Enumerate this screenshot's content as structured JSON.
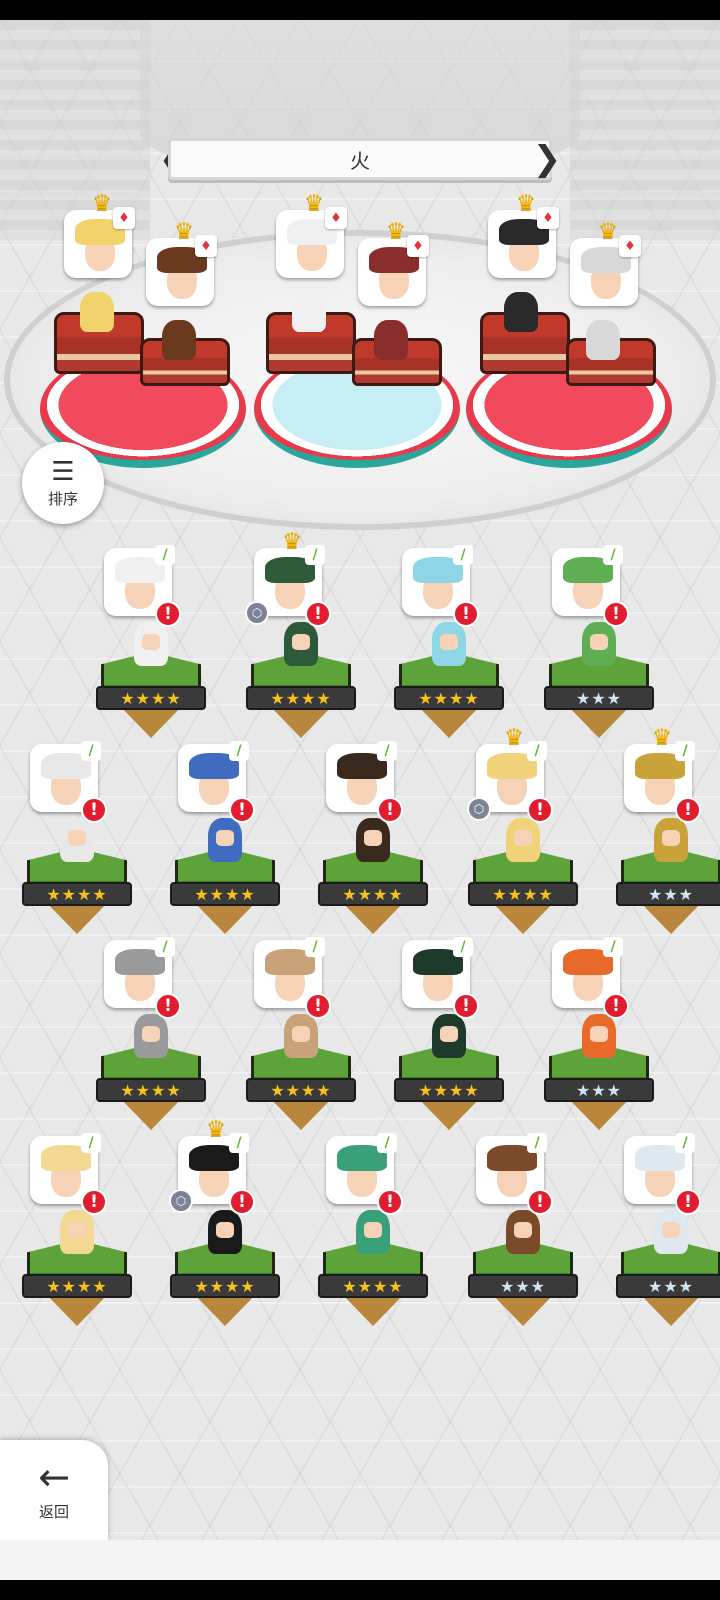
{
  "header": {
    "element_label": "火",
    "prev_arrow": "❮",
    "next_arrow": "❯"
  },
  "sort_button": {
    "icon": "sort-icon",
    "label": "排序"
  },
  "back_button": {
    "icon": "arrow-left-icon",
    "label": "返回"
  },
  "icons": {
    "crown": "♛",
    "fire_badge": "♦",
    "leaf_badge": "/",
    "alert": "!",
    "gem": "⬡"
  },
  "colors": {
    "alert": "#e21c2f",
    "gold_star": "#f7c21b",
    "silver_star": "#cfe4f4",
    "grass": "#5ea33a",
    "pedestal_red": "#f04a5c",
    "pedestal_blue": "#c6eef4"
  },
  "team": [
    {
      "crown": true,
      "badge": "fire",
      "hair": "#f2d36b"
    },
    {
      "crown": true,
      "badge": "fire",
      "hair": "#6b3a1e"
    },
    {
      "crown": true,
      "badge": "fire",
      "hair": "#f0f0f0"
    },
    {
      "crown": true,
      "badge": "fire",
      "hair": "#8a2d2d"
    },
    {
      "crown": true,
      "badge": "fire",
      "hair": "#2a2a2a"
    },
    {
      "crown": true,
      "badge": "fire",
      "hair": "#d8d8d8"
    }
  ],
  "heroes": [
    {
      "stars": "★★★★",
      "tier": "gold",
      "crown": false,
      "gem": false,
      "hair": "#f0f0f0"
    },
    {
      "stars": "★★★★",
      "tier": "gold",
      "crown": true,
      "gem": true,
      "hair": "#2f5a3a"
    },
    {
      "stars": "★★★★",
      "tier": "gold",
      "crown": false,
      "gem": false,
      "hair": "#8ed6e6"
    },
    {
      "stars": "★★★",
      "tier": "silver",
      "crown": false,
      "gem": false,
      "hair": "#5fae54"
    },
    {
      "stars": "★★★★",
      "tier": "gold",
      "crown": false,
      "gem": false,
      "hair": "#e8e8e8"
    },
    {
      "stars": "★★★★",
      "tier": "gold",
      "crown": false,
      "gem": false,
      "hair": "#3f6cc0"
    },
    {
      "stars": "★★★★",
      "tier": "gold",
      "crown": false,
      "gem": false,
      "hair": "#3a2a1e"
    },
    {
      "stars": "★★★★",
      "tier": "gold",
      "crown": true,
      "gem": true,
      "hair": "#f0d27a"
    },
    {
      "stars": "★★★",
      "tier": "silver",
      "crown": true,
      "gem": false,
      "hair": "#c9a23a"
    },
    {
      "stars": "★★★★",
      "tier": "gold",
      "crown": false,
      "gem": false,
      "hair": "#9a9a9a"
    },
    {
      "stars": "★★★★",
      "tier": "gold",
      "crown": false,
      "gem": false,
      "hair": "#c9a27a"
    },
    {
      "stars": "★★★★",
      "tier": "gold",
      "crown": false,
      "gem": false,
      "hair": "#1e3a2a"
    },
    {
      "stars": "★★★",
      "tier": "silver",
      "crown": false,
      "gem": false,
      "hair": "#e86a2a"
    },
    {
      "stars": "★★★★",
      "tier": "gold",
      "crown": false,
      "gem": false,
      "hair": "#f2d890"
    },
    {
      "stars": "★★★★",
      "tier": "gold",
      "crown": true,
      "gem": true,
      "hair": "#1a1a1a"
    },
    {
      "stars": "★★★★",
      "tier": "gold",
      "crown": false,
      "gem": false,
      "hair": "#3aa07a"
    },
    {
      "stars": "★★★",
      "tier": "silver",
      "crown": false,
      "gem": false,
      "hair": "#7a4a2a"
    },
    {
      "stars": "★★★",
      "tier": "silver",
      "crown": false,
      "gem": false,
      "hair": "#dfe8ee"
    }
  ],
  "partial_left_stars": [
    "★★",
    "★★"
  ],
  "partial_left_stars_first": "★★"
}
